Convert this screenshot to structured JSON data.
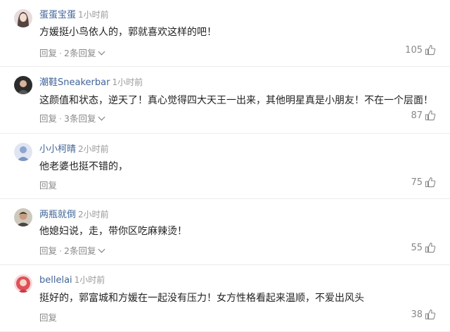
{
  "comments": [
    {
      "user": "蛋蛋宝蛋",
      "time": "1小时前",
      "text": "方媛挺小鸟依人的，郭就喜欢这样的吧！",
      "reply_label": "回复",
      "separator": "·",
      "replies_label": "2条回复",
      "likes": "105",
      "avatar_icon": "avatar-woman-icon",
      "avatar_color": "#d9c7c7"
    },
    {
      "user": "潮鞋Sneakerbar",
      "time": "1小时前",
      "text": "这颜值和状态，逆天了！真心觉得四大天王一出来，其他明星真是小朋友！不在一个层面！",
      "reply_label": "回复",
      "separator": "·",
      "replies_label": "3条回复",
      "likes": "87",
      "avatar_icon": "avatar-dark-icon",
      "avatar_color": "#2c2c2c"
    },
    {
      "user": "小小柯晴",
      "time": "2小时前",
      "text": "他老婆也挺不错的，",
      "reply_label": "回复",
      "separator": "",
      "replies_label": "",
      "likes": "75",
      "avatar_icon": "avatar-blue-icon",
      "avatar_color": "#9fb4d8"
    },
    {
      "user": "两瓶就倒",
      "time": "2小时前",
      "text": "他媳妇说，走，带你区吃麻辣烫！",
      "reply_label": "回复",
      "separator": "·",
      "replies_label": "2条回复",
      "likes": "55",
      "avatar_icon": "avatar-man-icon",
      "avatar_color": "#6f6a62"
    },
    {
      "user": "bellelai",
      "time": "1小时前",
      "text": "挺好的，郭富城和方媛在一起没有压力！女方性格看起来温顺，不爱出风头",
      "reply_label": "回复",
      "separator": "",
      "replies_label": "",
      "likes": "38",
      "avatar_icon": "avatar-red-icon",
      "avatar_color": "#e0505a"
    }
  ],
  "colors": {
    "username": "#406599",
    "meta_gray": "#999999",
    "divider": "#ececec"
  },
  "icons": {
    "like": "thumbs-up-icon",
    "expand": "chevron-down-icon"
  }
}
